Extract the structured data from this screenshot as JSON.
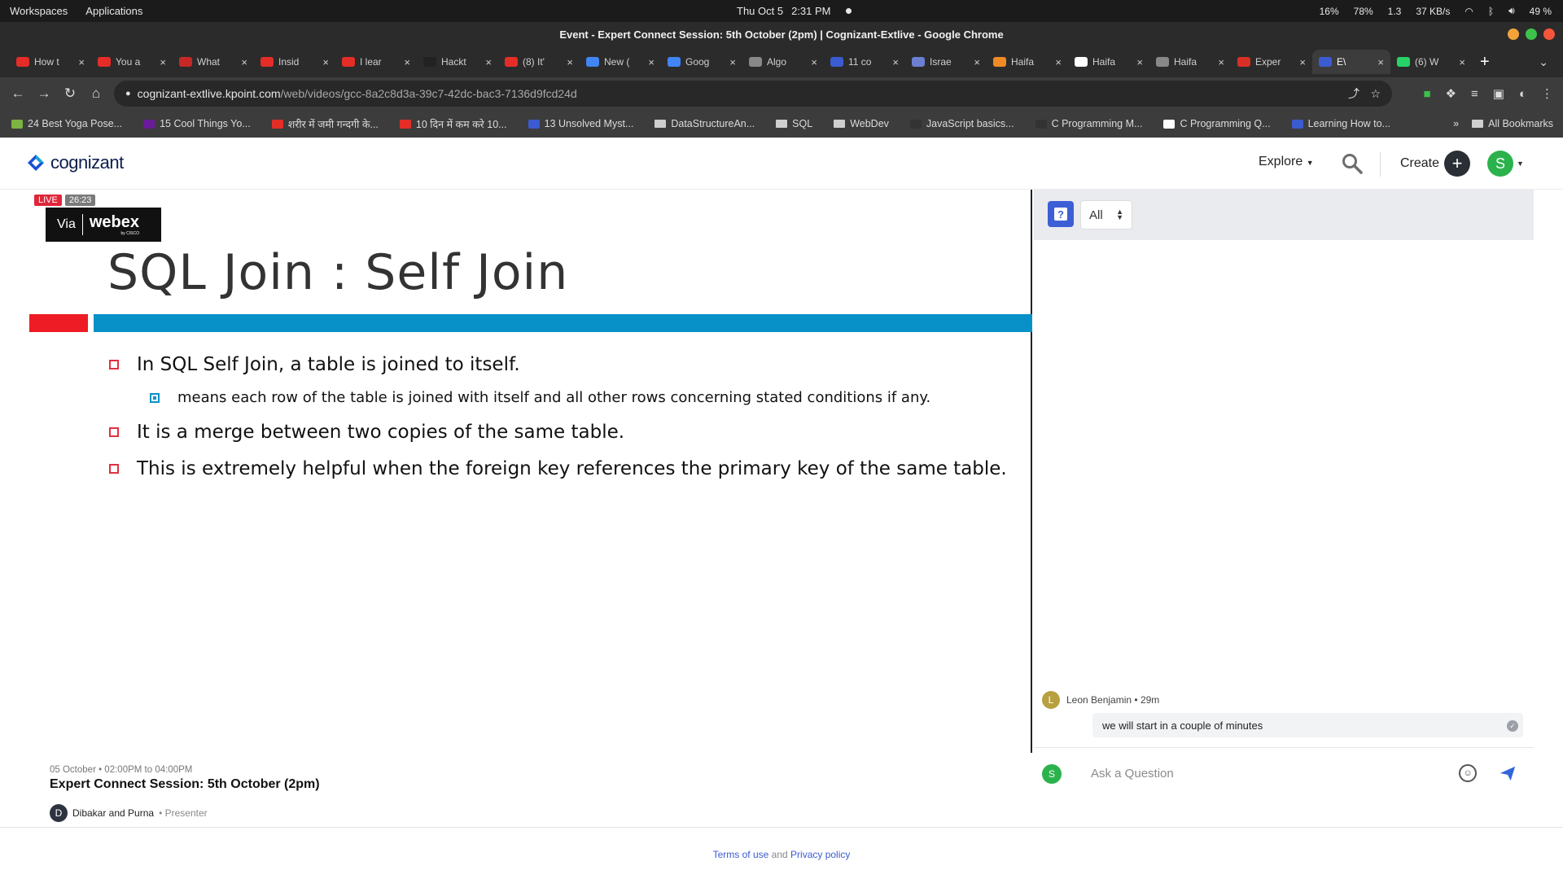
{
  "os": {
    "workspaces": "Workspaces",
    "applications": "Applications",
    "clock": "Thu Oct 5",
    "time": "2:31 PM",
    "cpu": "16%",
    "memory": "78%",
    "load": "1.3",
    "network": "37 KB/s",
    "battery": "49 %"
  },
  "browser": {
    "window_title": "Event - Expert Connect Session: 5th October (2pm) | Cognizant-Extlive - Google Chrome",
    "tabs": [
      {
        "label": "How t",
        "color": "#e52d27"
      },
      {
        "label": "You a",
        "color": "#e52d27"
      },
      {
        "label": "What",
        "color": "#c62828"
      },
      {
        "label": "Insid",
        "color": "#e52d27"
      },
      {
        "label": "I lear",
        "color": "#e52d27"
      },
      {
        "label": "Hackt",
        "color": "#222222"
      },
      {
        "label": "(8) It'",
        "color": "#e52d27"
      },
      {
        "label": "New (",
        "color": "#4285f4"
      },
      {
        "label": "Goog",
        "color": "#4285f4"
      },
      {
        "label": "Algo",
        "color": "#888888"
      },
      {
        "label": "11 co",
        "color": "#3b5bd0"
      },
      {
        "label": "Israe",
        "color": "#6d7fd0"
      },
      {
        "label": "Haifa",
        "color": "#f08a24"
      },
      {
        "label": "Haifa",
        "color": "#ffffff"
      },
      {
        "label": "Haifa",
        "color": "#888888"
      },
      {
        "label": "Exper",
        "color": "#d93025"
      },
      {
        "label": "E\\",
        "color": "#3b5bd0"
      },
      {
        "label": "(6) W",
        "color": "#25d366"
      }
    ],
    "url_host": "cognizant-extlive.kpoint.com",
    "url_path": "/web/videos/gcc-8a2c8d3a-39c7-42dc-bac3-7136d9fcd24d",
    "bookmarks": [
      {
        "label": "24 Best Yoga Pose...",
        "color": "#7cb342"
      },
      {
        "label": "15 Cool Things Yo...",
        "color": "#6a1b9a"
      },
      {
        "label": "शरीर में जमी गन्दगी के...",
        "color": "#e52d27"
      },
      {
        "label": "10 दिन में कम करे 10...",
        "color": "#e52d27"
      },
      {
        "label": "13 Unsolved Myst...",
        "color": "#3b5bd0"
      },
      {
        "label": "DataStructureAn...",
        "folder": true
      },
      {
        "label": "SQL",
        "folder": true
      },
      {
        "label": "WebDev",
        "folder": true
      },
      {
        "label": "JavaScript basics...",
        "color": "#333333"
      },
      {
        "label": "C Programming M...",
        "color": "#333333"
      },
      {
        "label": "C Programming Q...",
        "color": "#ffffff"
      },
      {
        "label": "Learning How to...",
        "color": "#3b5bd0"
      }
    ],
    "overflow": "»",
    "all_bookmarks": "All Bookmarks"
  },
  "site": {
    "logo_text": "cognizant",
    "explore": "Explore",
    "create": "Create",
    "avatar_initial": "S"
  },
  "video": {
    "live": "LIVE",
    "elapsed": "26:23",
    "via": "Via",
    "brand": "webex",
    "brand_sub": "by CISCO",
    "slide": {
      "title": "SQL Join : Self Join",
      "bullets": [
        "In SQL Self Join, a table is joined to itself.",
        "means each row of the table is joined with itself and all other rows concerning stated conditions if any.",
        "It is a merge between two copies of the same table.",
        "This is extremely helpful when the foreign key references the primary key of the same table."
      ]
    }
  },
  "event": {
    "date": "05 October • 02:00PM to 04:00PM",
    "title": "Expert Connect Session: 5th October (2pm)",
    "presenter_initial": "D",
    "presenter": "Dibakar and Purna",
    "presenter_role": "• Presenter"
  },
  "qa": {
    "filter": "All",
    "messages": [
      {
        "initial": "L",
        "author": "Leon Benjamin",
        "meta": "• 29m",
        "text": "we will start in a couple of minutes"
      }
    ],
    "ask_initial": "S",
    "ask_placeholder": "Ask a Question"
  },
  "footer": {
    "terms": "Terms of use",
    "and": "and",
    "privacy": "Privacy policy"
  }
}
